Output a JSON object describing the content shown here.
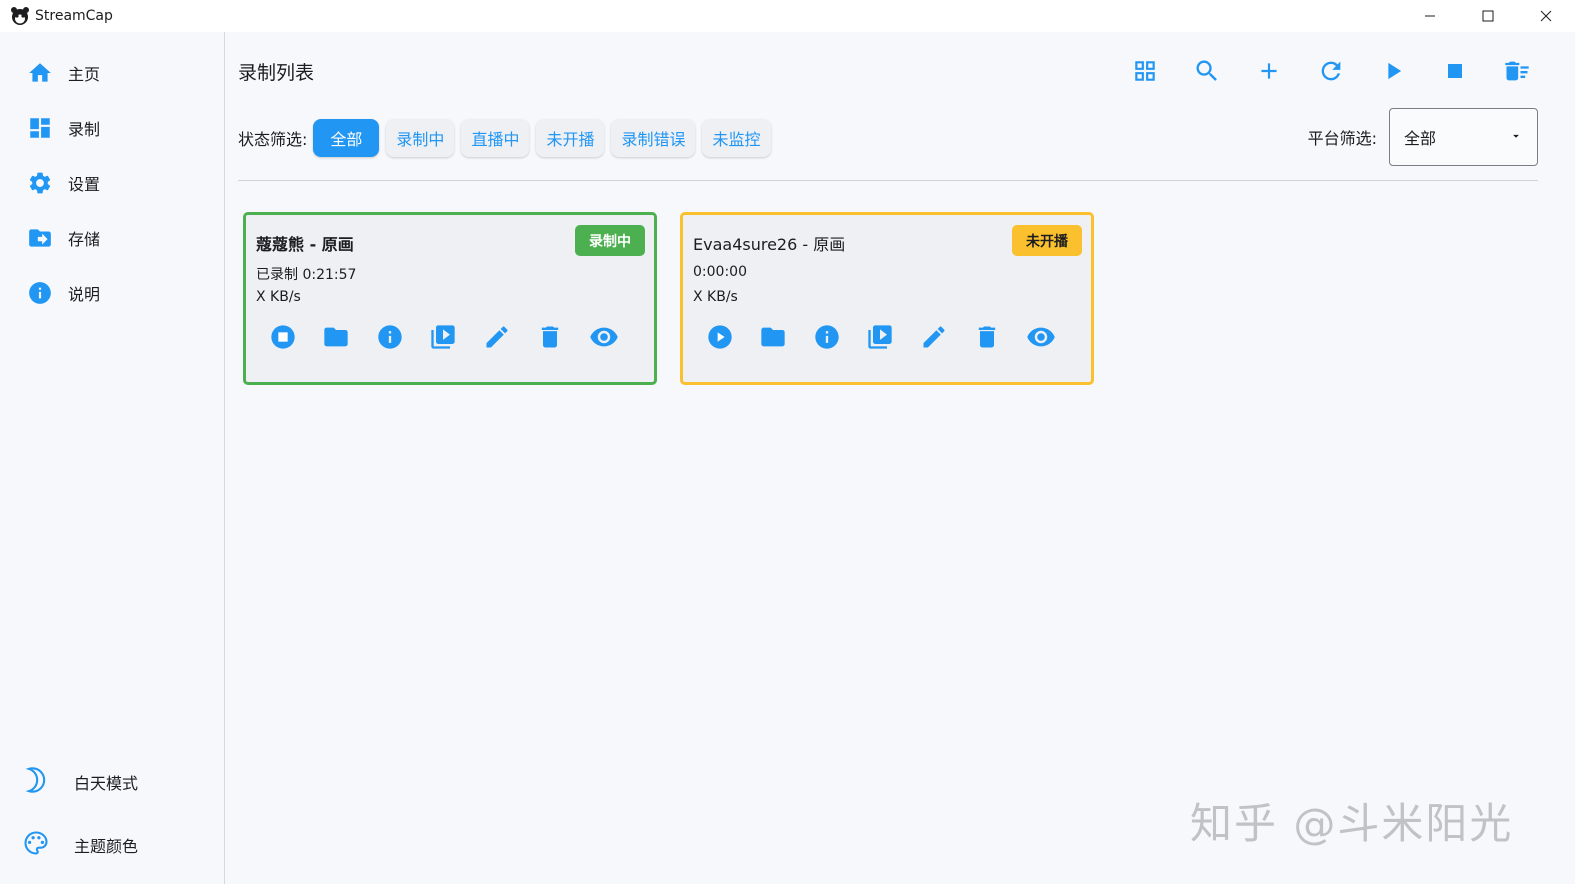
{
  "window": {
    "title": "StreamCap"
  },
  "sidebar": {
    "items": [
      {
        "label": "主页",
        "icon": "home-icon"
      },
      {
        "label": "录制",
        "icon": "dashboard-icon"
      },
      {
        "label": "设置",
        "icon": "gear-icon"
      },
      {
        "label": "存储",
        "icon": "folder-arrow-icon"
      },
      {
        "label": "说明",
        "icon": "info-icon"
      }
    ],
    "bottom": [
      {
        "label": "白天模式",
        "icon": "moon-icon"
      },
      {
        "label": "主题颜色",
        "icon": "palette-icon"
      }
    ]
  },
  "main": {
    "title": "录制列表",
    "toolbar": [
      "grid-view-icon",
      "search-icon",
      "add-icon",
      "refresh-icon",
      "play-icon",
      "stop-icon",
      "delete-all-icon"
    ],
    "status_filter": {
      "label": "状态筛选:",
      "options": [
        "全部",
        "录制中",
        "直播中",
        "未开播",
        "录制错误",
        "未监控"
      ],
      "selected": "全部"
    },
    "platform_filter": {
      "label": "平台筛选:",
      "value": "全部"
    }
  },
  "cards": [
    {
      "title": "蔻蔻熊 - 原画",
      "status": "录制中",
      "line1": "已录制 0:21:57",
      "line2": "X KB/s",
      "status_color": "#4caf50"
    },
    {
      "title": "Evaa4sure26 - 原画",
      "status": "未开播",
      "line1": "0:00:00",
      "line2": "X KB/s",
      "status_color": "#fbc02d"
    }
  ],
  "watermark": "知乎 @斗米阳光",
  "colors": {
    "accent": "#2196f3",
    "recording": "#4caf50",
    "not_live": "#fbc02d"
  }
}
